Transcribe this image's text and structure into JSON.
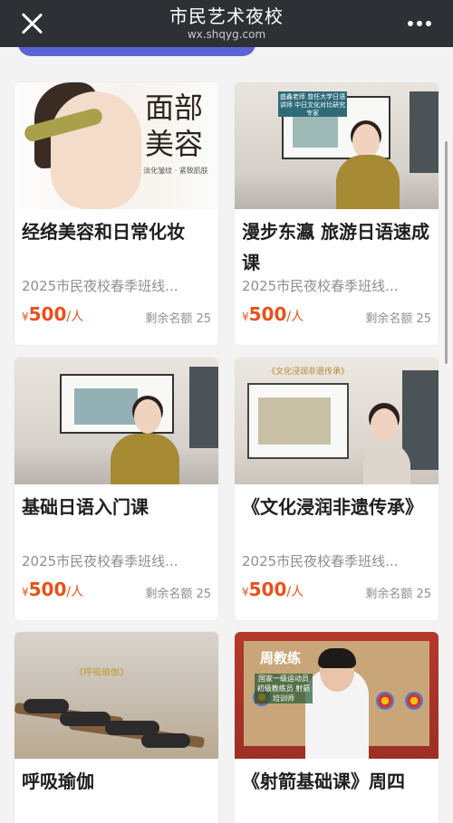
{
  "header": {
    "title": "市民艺术夜校",
    "url": "wx.shqyg.com"
  },
  "courses": [
    {
      "title": "经络美容和日常化妆",
      "subtitle": "2025市民夜校春季班线...",
      "currency": "¥",
      "price": "500",
      "unit": "/人",
      "quota": "剩余名额 25",
      "thumb_text": "面部美容",
      "thumb_caption": "淡化皱纹 · 紧致肌肤"
    },
    {
      "title": "漫步东瀛 旅游日语速成课",
      "subtitle": "2025市民夜校春季班线...",
      "currency": "¥",
      "price": "500",
      "unit": "/人",
      "quota": "剩余名额 25",
      "thumb_text": "盛鑫老师 曾任大学日语讲师 中日文化对比研究专家"
    },
    {
      "title": "基础日语入门课",
      "subtitle": "2025市民夜校春季班线...",
      "currency": "¥",
      "price": "500",
      "unit": "/人",
      "quota": "剩余名额 25"
    },
    {
      "title": "《文化浸润非遗传承》",
      "subtitle": "2025市民夜校春季班线...",
      "currency": "¥",
      "price": "500",
      "unit": "/人",
      "quota": "剩余名额 25",
      "thumb_text": "《文化浸润非遗传承》"
    },
    {
      "title": "呼吸瑜伽",
      "thumb_text": "《呼吸瑜伽》"
    },
    {
      "title": "《射箭基础课》周四",
      "thumb_name": "周教练",
      "thumb_text": "国家一级运动员 初级教练员 射箭培训师"
    }
  ],
  "colors": {
    "header_bg": "#2d3034",
    "price": "#e8501a",
    "accent_stub": "#5b64d3"
  }
}
